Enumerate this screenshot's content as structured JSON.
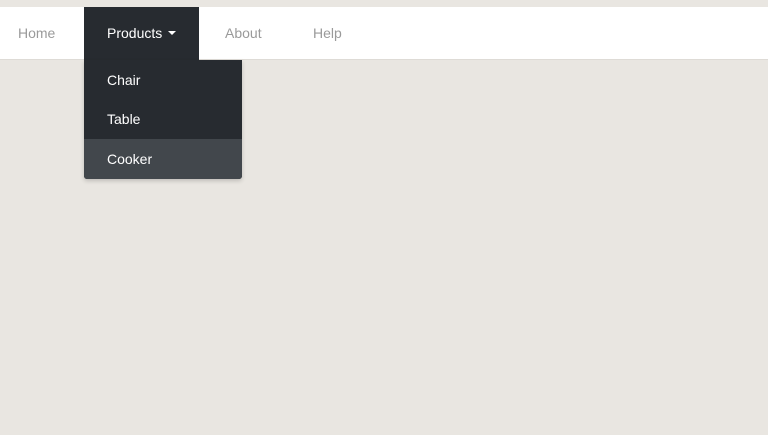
{
  "navbar": {
    "items": [
      {
        "label": "Home"
      },
      {
        "label": "Products",
        "has_dropdown": true,
        "active": true
      },
      {
        "label": "About"
      },
      {
        "label": "Help"
      }
    ]
  },
  "dropdown": {
    "items": [
      {
        "label": "Chair"
      },
      {
        "label": "Table"
      },
      {
        "label": "Cooker",
        "highlighted": true
      }
    ]
  },
  "colors": {
    "page_background": "#e9e6e1",
    "navbar_background": "#ffffff",
    "active_background": "#272b30",
    "hover_background": "#42474c",
    "inactive_text": "#9a9a9a",
    "active_text": "#ffffff"
  },
  "icons": {
    "products_caret": "caret-down-icon"
  }
}
